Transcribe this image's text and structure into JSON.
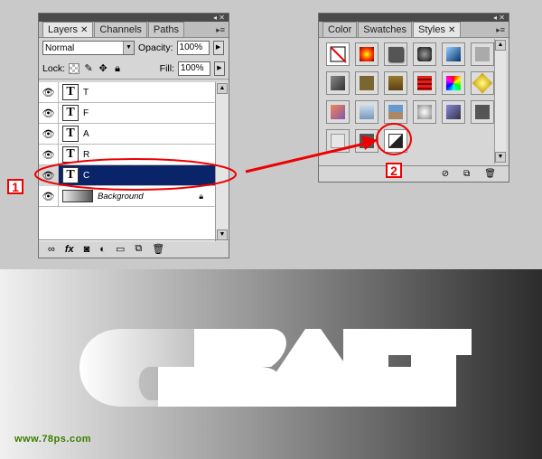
{
  "layers_panel": {
    "tabs": [
      {
        "label": "Layers",
        "close": "✕",
        "active": true
      },
      {
        "label": "Channels",
        "active": false
      },
      {
        "label": "Paths",
        "active": false
      }
    ],
    "blend_mode": "Normal",
    "opacity_label": "Opacity:",
    "opacity_value": "100%",
    "lock_label": "Lock:",
    "fill_label": "Fill:",
    "fill_value": "100%",
    "layers": [
      {
        "name": "T",
        "visible": true,
        "selected": false
      },
      {
        "name": "F",
        "visible": true,
        "selected": false
      },
      {
        "name": "A",
        "visible": true,
        "selected": false
      },
      {
        "name": "R",
        "visible": true,
        "selected": false
      },
      {
        "name": "C",
        "visible": true,
        "selected": true
      },
      {
        "name": "Background",
        "visible": true,
        "selected": false,
        "locked": true
      }
    ]
  },
  "styles_panel": {
    "tabs": [
      {
        "label": "Color",
        "active": false
      },
      {
        "label": "Swatches",
        "active": false
      },
      {
        "label": "Styles",
        "close": "✕",
        "active": true
      }
    ]
  },
  "annotations": {
    "step1": "1",
    "step2": "2",
    "accent_color": "#e00000"
  },
  "artwork": {
    "text": "CRAFT"
  },
  "watermark": "www.78ps.com"
}
